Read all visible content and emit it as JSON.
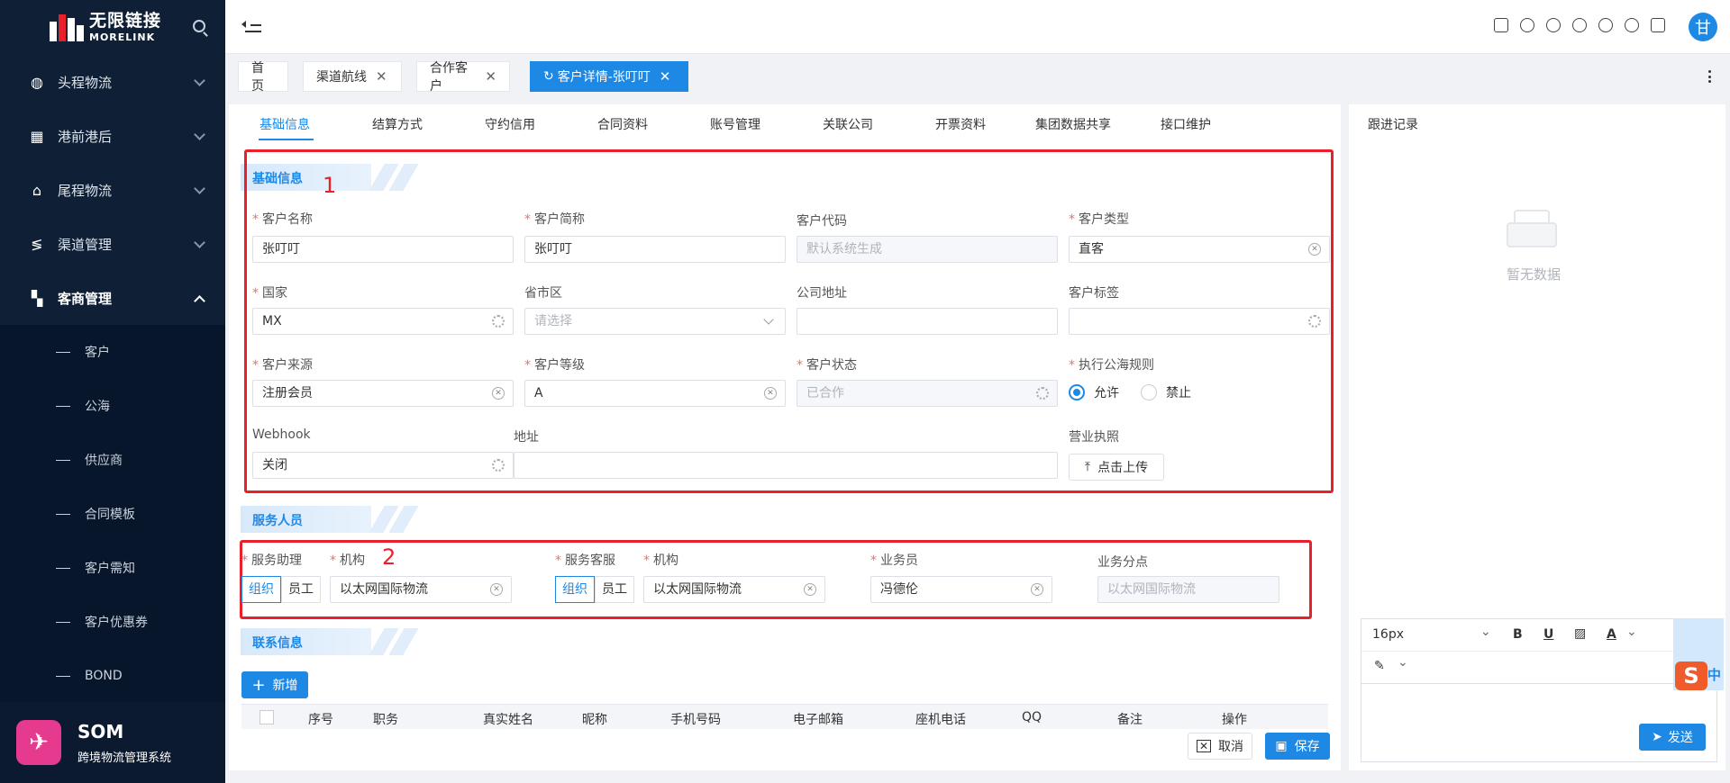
{
  "logo": {
    "cn": "无限链接",
    "en": "MORELINK"
  },
  "sidebar": {
    "groups": [
      {
        "label": "头程物流",
        "icon": "globe-icon"
      },
      {
        "label": "港前港后",
        "icon": "grid-icon"
      },
      {
        "label": "尾程物流",
        "icon": "home-icon"
      },
      {
        "label": "渠道管理",
        "icon": "route-icon"
      },
      {
        "label": "客商管理",
        "icon": "users-icon"
      }
    ],
    "sub_items": [
      "客户",
      "公海",
      "供应商",
      "合同模板",
      "客户需知",
      "客户优惠券",
      "BOND"
    ],
    "brand_name": "SOM",
    "brand_desc": "跨境物流管理系统"
  },
  "header": {
    "avatar_char": "甘"
  },
  "page_tabs": [
    "首页",
    "渠道航线",
    "合作客户",
    "客户详情-张叮叮"
  ],
  "sub_tabs": [
    "基础信息",
    "结算方式",
    "守约信用",
    "合同资料",
    "账号管理",
    "关联公司",
    "开票资料",
    "集团数据共享",
    "接口维护"
  ],
  "sections": {
    "basic": "基础信息",
    "service": "服务人员",
    "contact": "联系信息"
  },
  "annotations": [
    "1",
    "2"
  ],
  "basic_form": {
    "customer_name": {
      "label": "客户名称",
      "value": "张叮叮"
    },
    "short_name": {
      "label": "客户简称",
      "value": "张叮叮"
    },
    "customer_code": {
      "label": "客户代码",
      "placeholder": "默认系统生成"
    },
    "customer_type": {
      "label": "客户类型",
      "value": "直客"
    },
    "country": {
      "label": "国家",
      "value": "MX"
    },
    "region": {
      "label": "省市区",
      "placeholder": "请选择"
    },
    "company_address": {
      "label": "公司地址",
      "value": ""
    },
    "customer_tag": {
      "label": "客户标签",
      "value": ""
    },
    "source": {
      "label": "客户来源",
      "value": "注册会员"
    },
    "level": {
      "label": "客户等级",
      "value": "A"
    },
    "status": {
      "label": "客户状态",
      "value": "已合作"
    },
    "sea_rule": {
      "label": "执行公海规则",
      "allow": "允许",
      "deny": "禁止",
      "selected": "允许"
    },
    "webhook": {
      "label": "Webhook",
      "value": "关闭"
    },
    "address": {
      "label": "地址",
      "value": ""
    },
    "license": {
      "label": "营业执照",
      "button": "点击上传"
    }
  },
  "service_form": {
    "assistant_label": "服务助理",
    "org_label": "机构",
    "seg_org": "组织",
    "seg_staff": "员工",
    "assistant_org": "以太网国际物流",
    "cs_label": "服务客服",
    "cs_org": "以太网国际物流",
    "sales_label": "业务员",
    "sales_value": "冯德伦",
    "branch_label": "业务分点",
    "branch_placeholder": "以太网国际物流"
  },
  "contact": {
    "add_button": "新增",
    "columns": [
      "序号",
      "职务",
      "真实姓名",
      "昵称",
      "手机号码",
      "电子邮箱",
      "座机电话",
      "QQ",
      "备注",
      "操作"
    ]
  },
  "footer_buttons": {
    "cancel": "取消",
    "save": "保存"
  },
  "follow": {
    "title": "跟进记录",
    "empty": "暂无数据",
    "font_size": "16px",
    "send": "发送"
  },
  "colors": {
    "primary": "#1e88e5",
    "sidebar": "#0f2036",
    "annotation": "#e8202a"
  }
}
